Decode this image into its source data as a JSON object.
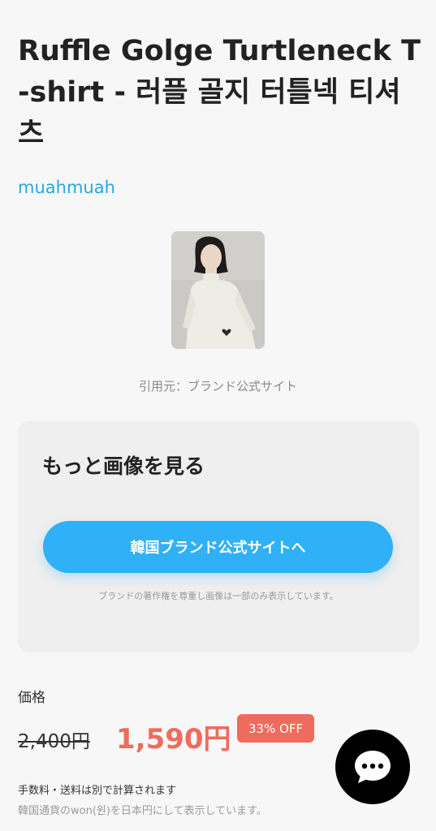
{
  "product": {
    "title": "Ruffle Golge Turtleneck T-shirt - 러플 골지 터틀넥 티셔츠",
    "brand": "muahmuah",
    "image_icon": "product-photo",
    "source_note": "引用元：ブランド公式サイト"
  },
  "more_images": {
    "heading": "もっと画像を見る",
    "button_label": "韓国ブランド公式サイトへ",
    "copyright_note": "ブランドの著作権を尊重し画像は一部のみ表示しています。"
  },
  "pricing": {
    "label": "価格",
    "original_price": "2,400円",
    "sale_price": "1,590円",
    "discount_badge": "33% OFF",
    "fee_note": "手数料・送料は別で計算されます",
    "currency_note": "韓国通貨のwon(원)を日本円にして表示しています。"
  },
  "chat": {
    "icon": "chat-bubble-icon"
  },
  "colors": {
    "brand_link": "#27a7e0",
    "primary_button": "#2fb0f7",
    "sale": "#ee6c5e",
    "chat": "#000000"
  }
}
